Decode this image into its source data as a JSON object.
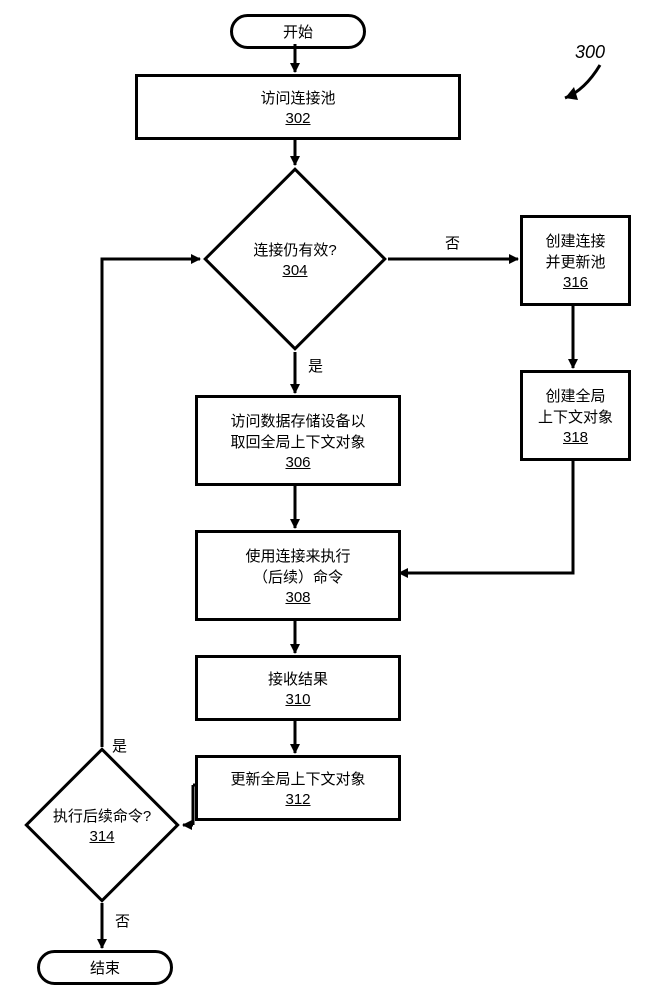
{
  "figure_ref": "300",
  "terminator": {
    "start": "开始",
    "end": "结束"
  },
  "steps": {
    "s302": {
      "text": "访问连接池",
      "ref": "302"
    },
    "s304": {
      "text": "连接仍有效?",
      "ref": "304"
    },
    "s306": {
      "text1": "访问数据存储设备以",
      "text2": "取回全局上下文对象",
      "ref": "306"
    },
    "s308": {
      "text1": "使用连接来执行",
      "text2": "（后续）命令",
      "ref": "308"
    },
    "s310": {
      "text": "接收结果",
      "ref": "310"
    },
    "s312": {
      "text": "更新全局上下文对象",
      "ref": "312"
    },
    "s314": {
      "text": "执行后续命令?",
      "ref": "314"
    },
    "s316": {
      "text1": "创建连接",
      "text2": "并更新池",
      "ref": "316"
    },
    "s318": {
      "text1": "创建全局",
      "text2": "上下文对象",
      "ref": "318"
    }
  },
  "labels": {
    "no": "否",
    "yes": "是"
  },
  "chart_data": {
    "type": "flowchart",
    "nodes": [
      {
        "id": "start",
        "kind": "terminator",
        "label": "开始"
      },
      {
        "id": "302",
        "kind": "process",
        "label": "访问连接池"
      },
      {
        "id": "304",
        "kind": "decision",
        "label": "连接仍有效?"
      },
      {
        "id": "306",
        "kind": "process",
        "label": "访问数据存储设备以取回全局上下文对象"
      },
      {
        "id": "308",
        "kind": "process",
        "label": "使用连接来执行（后续）命令"
      },
      {
        "id": "310",
        "kind": "process",
        "label": "接收结果"
      },
      {
        "id": "312",
        "kind": "process",
        "label": "更新全局上下文对象"
      },
      {
        "id": "314",
        "kind": "decision",
        "label": "执行后续命令?"
      },
      {
        "id": "316",
        "kind": "process",
        "label": "创建连接并更新池"
      },
      {
        "id": "318",
        "kind": "process",
        "label": "创建全局上下文对象"
      },
      {
        "id": "end",
        "kind": "terminator",
        "label": "结束"
      }
    ],
    "edges": [
      {
        "from": "start",
        "to": "302"
      },
      {
        "from": "302",
        "to": "304"
      },
      {
        "from": "304",
        "to": "306",
        "label": "是"
      },
      {
        "from": "304",
        "to": "316",
        "label": "否"
      },
      {
        "from": "316",
        "to": "318"
      },
      {
        "from": "318",
        "to": "308"
      },
      {
        "from": "306",
        "to": "308"
      },
      {
        "from": "308",
        "to": "310"
      },
      {
        "from": "310",
        "to": "312"
      },
      {
        "from": "312",
        "to": "314"
      },
      {
        "from": "314",
        "to": "304",
        "label": "是",
        "note": "loop back up"
      },
      {
        "from": "314",
        "to": "end",
        "label": "否"
      }
    ]
  }
}
